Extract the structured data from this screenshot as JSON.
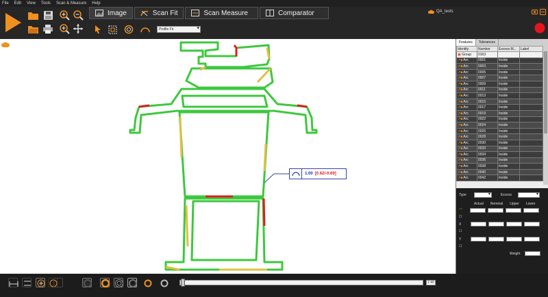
{
  "menu": [
    "File",
    "Edit",
    "View",
    "Tools",
    "Scan & Measure",
    "Help"
  ],
  "tabs": [
    {
      "label": "Image",
      "icon": "image-icon",
      "active": true
    },
    {
      "label": "Scan Fit",
      "icon": "scan-fit-icon",
      "active": false
    },
    {
      "label": "Scan Measure",
      "icon": "scan-measure-icon",
      "active": false
    },
    {
      "label": "Comparator",
      "icon": "comparator-icon",
      "active": false
    }
  ],
  "fit_mode": {
    "value": "Profile Fit"
  },
  "project": {
    "name": "QA_tests"
  },
  "measurement": {
    "value": "1.00",
    "range": "[0.62/-0.69]"
  },
  "panel": {
    "tabs": [
      "Features",
      "Tolerances"
    ],
    "columns": [
      "Identity",
      "Number",
      "Excess M...",
      "Label"
    ],
    "group": {
      "identity": "Group",
      "number": "0163"
    },
    "rows": [
      {
        "identity": "Arc",
        "number": "0001",
        "excess": "Inside"
      },
      {
        "identity": "Arc",
        "number": "0003",
        "excess": "Inside"
      },
      {
        "identity": "Arc",
        "number": "0005",
        "excess": "Inside"
      },
      {
        "identity": "Arc",
        "number": "0007",
        "excess": "Inside"
      },
      {
        "identity": "Arc",
        "number": "0009",
        "excess": "Inside"
      },
      {
        "identity": "Arc",
        "number": "0011",
        "excess": "Inside"
      },
      {
        "identity": "Arc",
        "number": "0013",
        "excess": "Inside"
      },
      {
        "identity": "Arc",
        "number": "0015",
        "excess": "Inside"
      },
      {
        "identity": "Arc",
        "number": "0017",
        "excess": "Inside"
      },
      {
        "identity": "Arc",
        "number": "0019",
        "excess": "Inside"
      },
      {
        "identity": "Arc",
        "number": "0022",
        "excess": "Inside"
      },
      {
        "identity": "Arc",
        "number": "0024",
        "excess": "Inside"
      },
      {
        "identity": "Arc",
        "number": "0026",
        "excess": "Inside"
      },
      {
        "identity": "Arc",
        "number": "0028",
        "excess": "Inside"
      },
      {
        "identity": "Arc",
        "number": "0030",
        "excess": "Inside"
      },
      {
        "identity": "Arc",
        "number": "0033",
        "excess": "Inside"
      },
      {
        "identity": "Arc",
        "number": "0034",
        "excess": "Inside"
      },
      {
        "identity": "Arc",
        "number": "0036",
        "excess": "Inside"
      },
      {
        "identity": "Arc",
        "number": "0038",
        "excess": "Inside"
      },
      {
        "identity": "Arc",
        "number": "0040",
        "excess": "Inside"
      },
      {
        "identity": "Arc",
        "number": "0042",
        "excess": "Inside"
      }
    ],
    "form": {
      "type_label": "Type",
      "excess_label": "Excess",
      "headers": [
        "Actual",
        "Nominal",
        "Upper",
        "Lower"
      ],
      "x_label": "X",
      "y_label": "Y",
      "weight_label": "Weight"
    }
  },
  "zoom": {
    "value": "2.40"
  },
  "colors": {
    "accent": "#f0901e",
    "record": "#e8141c",
    "fit_green": "#3cc83c",
    "fit_red": "#e11c1c",
    "fit_yellow": "#e0c040"
  }
}
